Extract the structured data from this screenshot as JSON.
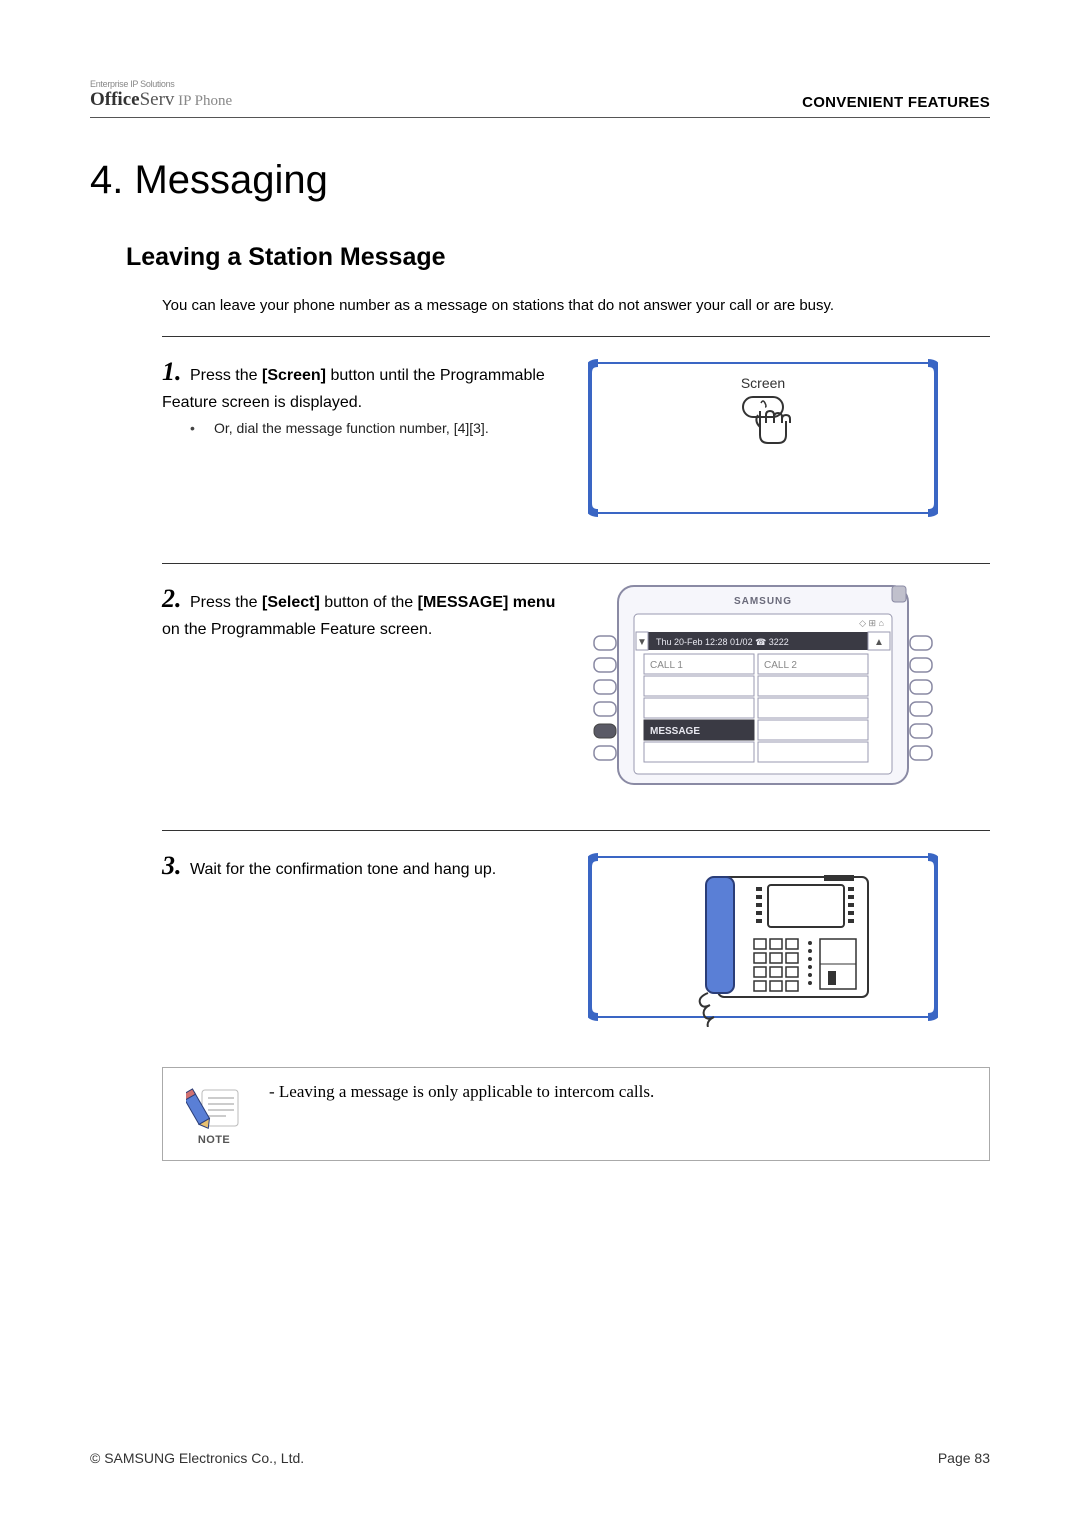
{
  "header": {
    "brand_tag": "Enterprise IP Solutions",
    "brand_office": "Office",
    "brand_serv": "Serv",
    "brand_ip": " IP Phone",
    "right": "CONVENIENT FEATURES"
  },
  "title": "4. Messaging",
  "subsection": "Leaving a Station Message",
  "intro": "You can leave your phone number as a message on stations that do not answer your call or are busy.",
  "steps": [
    {
      "num": "1.",
      "pre": " Press the ",
      "bold1": "[Screen]",
      "mid": " button until the Programmable Feature screen is displayed.",
      "bullet": "Or, dial the message function number, [4][3].",
      "illus_label": "Screen"
    },
    {
      "num": "2.",
      "pre": " Press the ",
      "bold1": "[Select]",
      "mid": " button of the ",
      "bold2": "[MESSAGE] menu",
      "tail": " on the Programmable Feature screen.",
      "lcd": {
        "brand": "SAMSUNG",
        "dateline": "Thu 20-Feb 12:28  01/02 ☎ 3222",
        "cells": [
          "CALL 1",
          "CALL 2",
          "",
          "",
          "",
          "",
          "MESSAGE",
          "",
          "",
          ""
        ]
      }
    },
    {
      "num": "3.",
      "pre": " Wait for the confirmation tone and hang up."
    }
  ],
  "note": {
    "label": "NOTE",
    "text": "- Leaving a message is only applicable to intercom calls."
  },
  "footer": {
    "left": "© SAMSUNG Electronics Co., Ltd.",
    "right": "Page 83"
  }
}
